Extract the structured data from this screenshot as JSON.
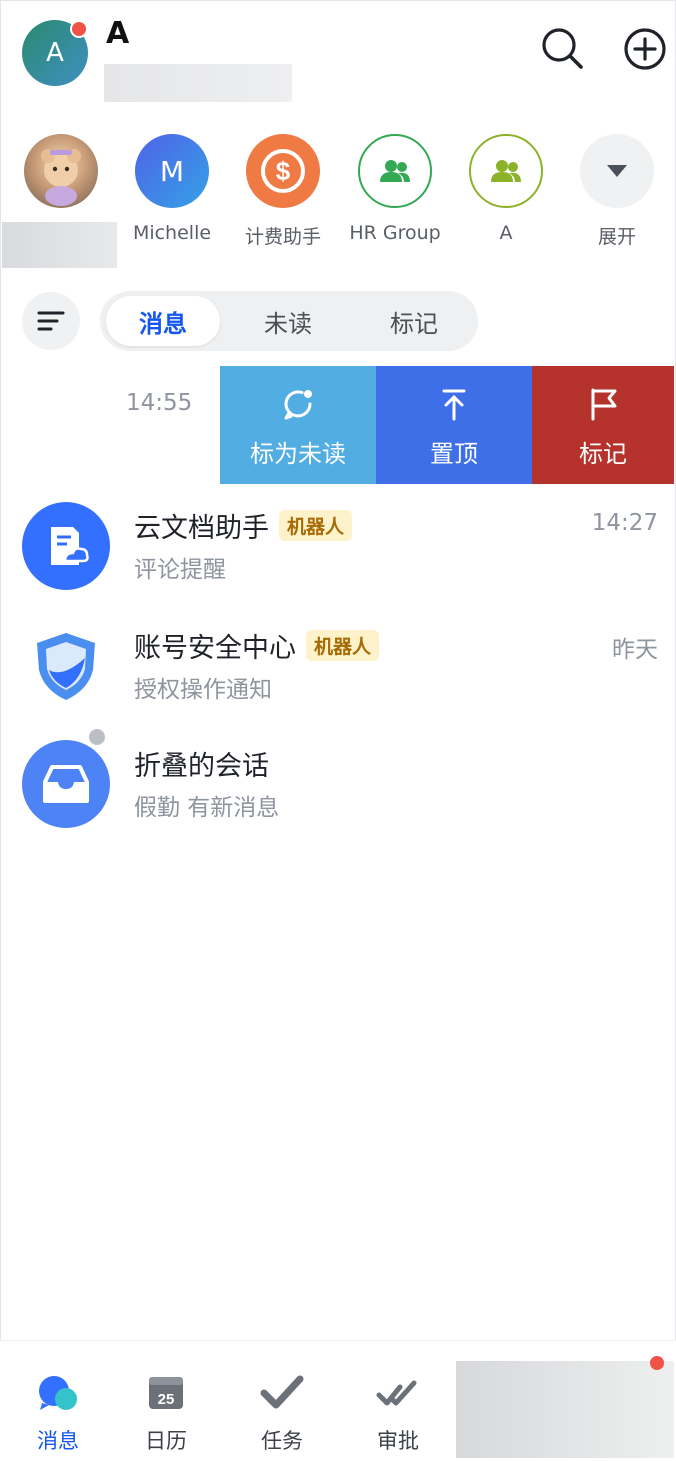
{
  "user": {
    "avatar_initial": "A",
    "name": "A"
  },
  "shortcuts": [
    {
      "label": ""
    },
    {
      "label": "Michelle",
      "initial": "M"
    },
    {
      "label": "计费助手"
    },
    {
      "label": "HR Group"
    },
    {
      "label": "A"
    },
    {
      "label": "展开"
    }
  ],
  "filters": {
    "tabs": [
      "消息",
      "未读",
      "标记"
    ],
    "active": "消息"
  },
  "swiped_row": {
    "time": "14:55",
    "actions": [
      {
        "label": "标为未读",
        "color": "#52ade3"
      },
      {
        "label": "置顶",
        "color": "#3e6ee8"
      },
      {
        "label": "标记",
        "color": "#b5332c"
      }
    ]
  },
  "chats": [
    {
      "title": "云文档助手",
      "badge": "机器人",
      "subtitle": "评论提醒",
      "time": "14:27"
    },
    {
      "title": "账号安全中心",
      "badge": "机器人",
      "subtitle": "授权操作通知",
      "time": "昨天"
    },
    {
      "title": "折叠的会话",
      "badge": "",
      "subtitle": "假勤 有新消息",
      "time": ""
    }
  ],
  "tabbar": {
    "tabs": [
      {
        "label": "消息",
        "active": true
      },
      {
        "label": "日历",
        "day": "25"
      },
      {
        "label": "任务"
      },
      {
        "label": "审批"
      }
    ]
  },
  "colors": {
    "accent": "#1456f0",
    "unread_dot": "#f05247",
    "bot_badge_bg": "#fdf2c9",
    "bot_badge_text": "#a66b04"
  }
}
